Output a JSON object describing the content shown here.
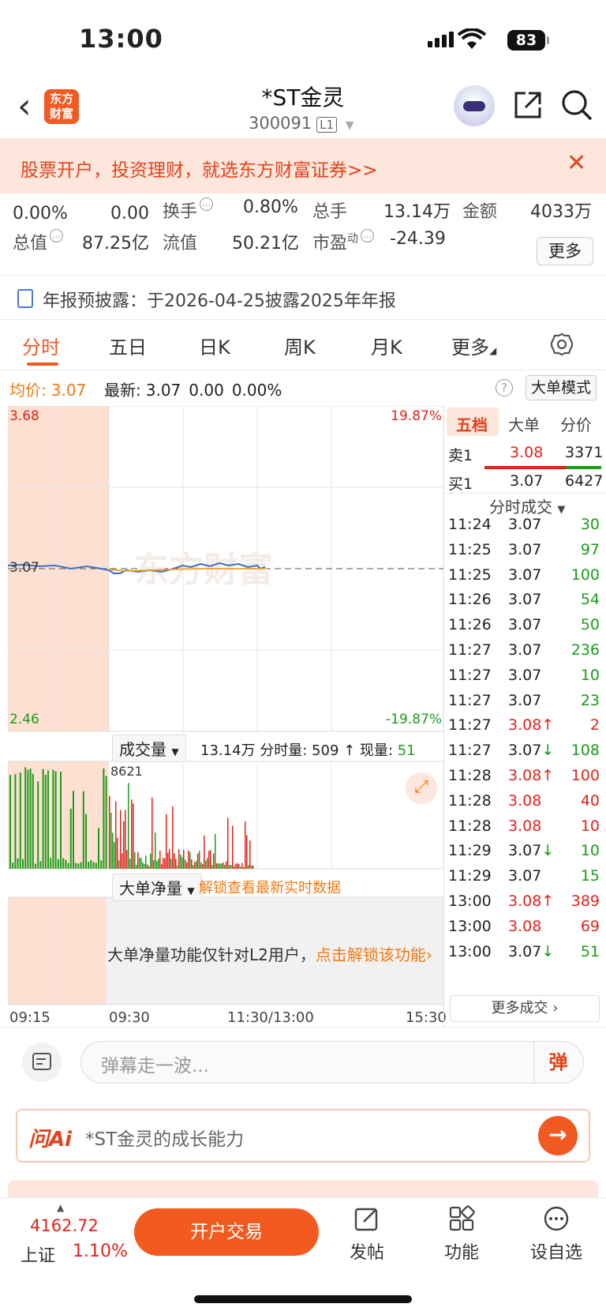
{
  "status": {
    "time": "13:00",
    "battery": "83"
  },
  "header": {
    "logo": "东方财富",
    "title": "*ST金灵",
    "code": "300091",
    "level": "L1"
  },
  "banner": {
    "text": "股票开户，投资理财，就选东方财富证券>>"
  },
  "quote": {
    "change_pct": "0.00%",
    "change": "0.00",
    "turnover_label": "换手",
    "turnover": "0.80%",
    "volume_label": "总手",
    "volume": "13.14万",
    "amount_label": "金额",
    "amount": "4033万",
    "mcap_label": "总值",
    "mcap": "87.25亿",
    "float_label": "流值",
    "float": "50.21亿",
    "pe_label": "市盈",
    "pe_sup": "动",
    "pe": "-24.39",
    "more": "更多"
  },
  "notice": {
    "text": "年报预披露：于2026-04-25披露2025年年报"
  },
  "tabs": [
    "分时",
    "五日",
    "日K",
    "周K",
    "月K",
    "更多"
  ],
  "avgbar": {
    "avg_label": "均价:",
    "avg": "3.07",
    "latest_label": "最新:",
    "latest": "3.07",
    "chg": "0.00",
    "pct": "0.00%",
    "bigmode": "大单模式"
  },
  "chart": {
    "price_high": "3.68",
    "price_low": "2.46",
    "price_mid": "3.07",
    "pct_high": "19.87%",
    "pct_low": "-19.87%",
    "watermark": "东方财富",
    "volume_selector": "成交量",
    "volume_info": "13.14万 分时量: 509 ↑ 现量: ",
    "volume_now": "51",
    "vol_max": "8621",
    "netflow_selector": "大单净量",
    "netflow_unlock": "解锁查看最新实时数据",
    "netflow_msg": "大单净量功能仅针对L2用户，",
    "netflow_link": "点击解锁该功能",
    "time_ticks": [
      "09:15",
      "09:30",
      "11:30/13:00",
      "15:30"
    ]
  },
  "orderbook": {
    "tabs": [
      "五档",
      "大单",
      "分价"
    ],
    "sell1_label": "卖1",
    "sell1_price": "3.08",
    "sell1_vol": "3371",
    "buy1_label": "买1",
    "buy1_price": "3.07",
    "buy1_vol": "6427",
    "trades_title": "分时成交",
    "trades": [
      {
        "t": "11:24",
        "p": "3.07",
        "v": "30",
        "c": "black",
        "vc": "green",
        "arrow": ""
      },
      {
        "t": "11:25",
        "p": "3.07",
        "v": "97",
        "c": "black",
        "vc": "green",
        "arrow": ""
      },
      {
        "t": "11:25",
        "p": "3.07",
        "v": "100",
        "c": "black",
        "vc": "green",
        "arrow": ""
      },
      {
        "t": "11:26",
        "p": "3.07",
        "v": "54",
        "c": "black",
        "vc": "green",
        "arrow": ""
      },
      {
        "t": "11:26",
        "p": "3.07",
        "v": "50",
        "c": "black",
        "vc": "green",
        "arrow": ""
      },
      {
        "t": "11:27",
        "p": "3.07",
        "v": "236",
        "c": "black",
        "vc": "green",
        "arrow": ""
      },
      {
        "t": "11:27",
        "p": "3.07",
        "v": "10",
        "c": "black",
        "vc": "green",
        "arrow": ""
      },
      {
        "t": "11:27",
        "p": "3.07",
        "v": "23",
        "c": "black",
        "vc": "green",
        "arrow": ""
      },
      {
        "t": "11:27",
        "p": "3.08",
        "v": "2",
        "c": "red",
        "vc": "red",
        "arrow": "↑"
      },
      {
        "t": "11:27",
        "p": "3.07",
        "v": "108",
        "c": "black",
        "vc": "green",
        "arrow": "↓"
      },
      {
        "t": "11:28",
        "p": "3.08",
        "v": "100",
        "c": "red",
        "vc": "red",
        "arrow": "↑"
      },
      {
        "t": "11:28",
        "p": "3.08",
        "v": "40",
        "c": "red",
        "vc": "red",
        "arrow": ""
      },
      {
        "t": "11:28",
        "p": "3.08",
        "v": "10",
        "c": "red",
        "vc": "red",
        "arrow": ""
      },
      {
        "t": "11:29",
        "p": "3.07",
        "v": "10",
        "c": "black",
        "vc": "green",
        "arrow": "↓"
      },
      {
        "t": "11:29",
        "p": "3.07",
        "v": "15",
        "c": "black",
        "vc": "green",
        "arrow": ""
      },
      {
        "t": "13:00",
        "p": "3.08",
        "v": "389",
        "c": "red",
        "vc": "red",
        "arrow": "↑"
      },
      {
        "t": "13:00",
        "p": "3.08",
        "v": "69",
        "c": "red",
        "vc": "red",
        "arrow": ""
      },
      {
        "t": "13:00",
        "p": "3.07",
        "v": "51",
        "c": "black",
        "vc": "green",
        "arrow": "↓"
      }
    ],
    "more_trades": "更多成交"
  },
  "comment": {
    "placeholder": "弹幕走一波...",
    "danmu": "弹"
  },
  "ask": {
    "logo": "问Ai",
    "text": "*ST金灵的成长能力"
  },
  "bottom": {
    "index_value": "4162.72",
    "index_name": "上证",
    "index_pct": "1.10%",
    "trade": "开户交易",
    "post": "发帖",
    "func": "功能",
    "watch": "设自选"
  },
  "colors": {
    "accent": "#f05a22",
    "up": "#e2231a",
    "down": "#1a9c1a",
    "price_line": "#3b6fc4",
    "avg_line": "#f0a020"
  }
}
